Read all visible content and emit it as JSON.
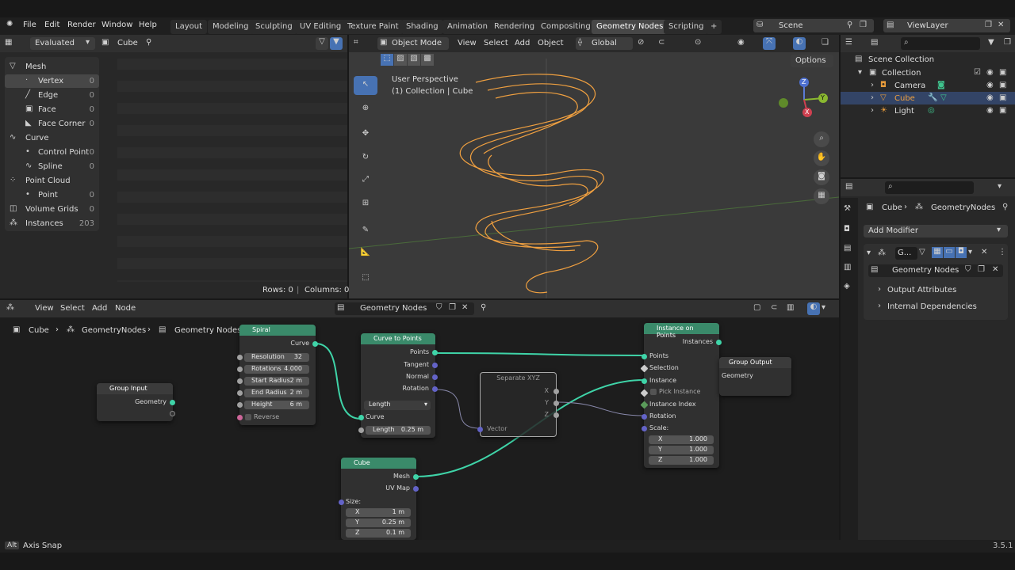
{
  "app": {
    "version": "3.5.1"
  },
  "menu": [
    "File",
    "Edit",
    "Render",
    "Window",
    "Help"
  ],
  "workspaces": [
    "Layout",
    "Modeling",
    "Sculpting",
    "UV Editing",
    "Texture Paint",
    "Shading",
    "Animation",
    "Rendering",
    "Compositing",
    "Geometry Nodes",
    "Scripting"
  ],
  "active_workspace": "Geometry Nodes",
  "scene": "Scene",
  "view_layer": "ViewLayer",
  "spreadsheet": {
    "mode": "Evaluated",
    "object": "Cube",
    "tree": [
      {
        "label": "Mesh",
        "count": "",
        "level": 0
      },
      {
        "label": "Vertex",
        "count": "0",
        "level": 1
      },
      {
        "label": "Edge",
        "count": "0",
        "level": 1
      },
      {
        "label": "Face",
        "count": "0",
        "level": 1
      },
      {
        "label": "Face Corner",
        "count": "0",
        "level": 1
      },
      {
        "label": "Curve",
        "count": "",
        "level": 0
      },
      {
        "label": "Control Point",
        "count": "0",
        "level": 1
      },
      {
        "label": "Spline",
        "count": "0",
        "level": 1
      },
      {
        "label": "Point Cloud",
        "count": "",
        "level": 0
      },
      {
        "label": "Point",
        "count": "0",
        "level": 1
      },
      {
        "label": "Volume Grids",
        "count": "0",
        "level": 0
      },
      {
        "label": "Instances",
        "count": "203",
        "level": 0
      }
    ],
    "rows": "Rows: 0",
    "columns": "Columns: 0"
  },
  "viewport": {
    "mode": "Object Mode",
    "menus": [
      "View",
      "Select",
      "Add",
      "Object"
    ],
    "orientation": "Global",
    "options": "Options",
    "overlay_title": "User Perspective",
    "overlay_sub": "(1) Collection | Cube",
    "gizmo": {
      "z": "Z",
      "y": "Y",
      "x": "X"
    }
  },
  "outliner": {
    "title": "Scene Collection",
    "items": [
      {
        "label": "Collection",
        "level": 0
      },
      {
        "label": "Camera",
        "level": 1
      },
      {
        "label": "Cube",
        "level": 1
      },
      {
        "label": "Light",
        "level": 1
      }
    ]
  },
  "properties": {
    "breadcrumb_object": "Cube",
    "breadcrumb_modifier": "GeometryNodes",
    "add_modifier": "Add Modifier",
    "modifier_short": "G...",
    "node_group": "Geometry Nodes",
    "sections": [
      "Output Attributes",
      "Internal Dependencies"
    ]
  },
  "node_editor": {
    "menus": [
      "View",
      "Select",
      "Add",
      "Node"
    ],
    "tree_name": "Geometry Nodes",
    "breadcrumb": [
      "Cube",
      "GeometryNodes",
      "Geometry Nodes"
    ],
    "nodes": {
      "group_input": {
        "title": "Group Input",
        "out": "Geometry"
      },
      "spiral": {
        "title": "Spiral",
        "out": "Curve",
        "fields": [
          {
            "label": "Resolution",
            "value": "32"
          },
          {
            "label": "Rotations",
            "value": "4.000"
          },
          {
            "label": "Start Radius",
            "value": "2 m"
          },
          {
            "label": "End Radius",
            "value": "2 m"
          },
          {
            "label": "Height",
            "value": "6 m"
          }
        ],
        "reverse": "Reverse"
      },
      "curve_to_points": {
        "title": "Curve to Points",
        "outs": [
          "Points",
          "Tangent",
          "Normal",
          "Rotation"
        ],
        "mode": "Length",
        "in_curve": "Curve",
        "length_label": "Length",
        "length_value": "0.25 m"
      },
      "separate_xyz": {
        "title": "Separate XYZ",
        "outs": [
          "X",
          "Y",
          "Z"
        ],
        "in": "Vector"
      },
      "instance_on_points": {
        "title": "Instance on Points",
        "out": "Instances",
        "ins": [
          "Points",
          "Selection",
          "Instance",
          "Pick Instance",
          "Instance Index",
          "Rotation",
          "Scale:"
        ],
        "scale": [
          {
            "axis": "X",
            "value": "1.000"
          },
          {
            "axis": "Y",
            "value": "1.000"
          },
          {
            "axis": "Z",
            "value": "1.000"
          }
        ]
      },
      "group_output": {
        "title": "Group Output",
        "in": "Geometry"
      },
      "cube": {
        "title": "Cube",
        "outs": [
          "Mesh",
          "UV Map"
        ],
        "size_label": "Size:",
        "size": [
          {
            "axis": "X",
            "value": "1 m"
          },
          {
            "axis": "Y",
            "value": "0.25 m"
          },
          {
            "axis": "Z",
            "value": "0.1 m"
          }
        ]
      }
    }
  },
  "status": {
    "key": "Alt",
    "text": "Axis Snap"
  },
  "colors": {
    "accent": "#4772b3",
    "geometry_socket": "#3fd4a8",
    "vector_socket": "#6363c7",
    "selected_orange": "#f0a040"
  }
}
